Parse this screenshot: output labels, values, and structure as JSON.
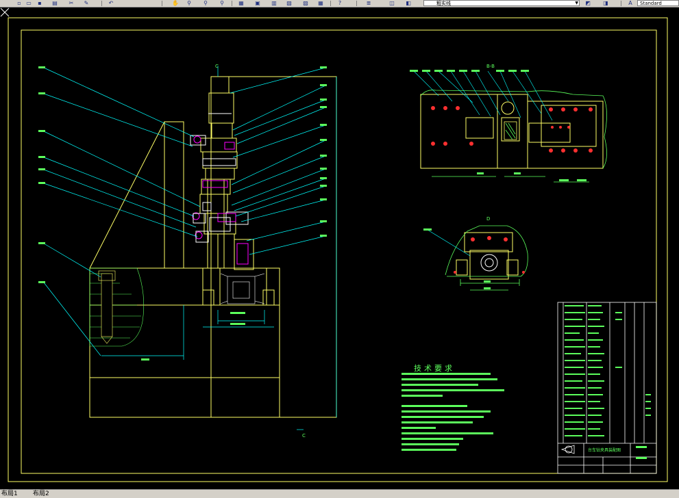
{
  "toolbar": {
    "icons": [
      "new-icon",
      "open-icon",
      "save-icon",
      "print-icon",
      "cut-icon",
      "match-properties-icon",
      "pan-icon",
      "zoom-realtime-icon",
      "zoom-window-icon",
      "zoom-previous-icon",
      "properties-icon",
      "design-center-icon",
      "tool-palettes-icon",
      "calculator-icon",
      "help-icon",
      "layers-icon",
      "layer-state-icon",
      "layer-previous-icon",
      "text-style-icon",
      "dimension-style-icon"
    ],
    "layer_combo_value": "粗实线",
    "style_combo_value": "Standard"
  },
  "drawing": {
    "section_label_bb": "B-B",
    "section_label_d": "D",
    "section_label_c_top": "C",
    "section_label_c_bottom": "C",
    "tech_requirements_title": "技术要求",
    "title_block_name": "台车钻夹具装配图"
  },
  "status": {
    "layout1": "布局1",
    "layout2": "布局2"
  },
  "colors": {
    "background": "#000000",
    "border": "#ffff66",
    "leader": "#00ffff",
    "part": "#ffff00",
    "green": "#5cff5c",
    "magenta": "#ff00ff",
    "white": "#ffffff",
    "red": "#ff3030"
  }
}
